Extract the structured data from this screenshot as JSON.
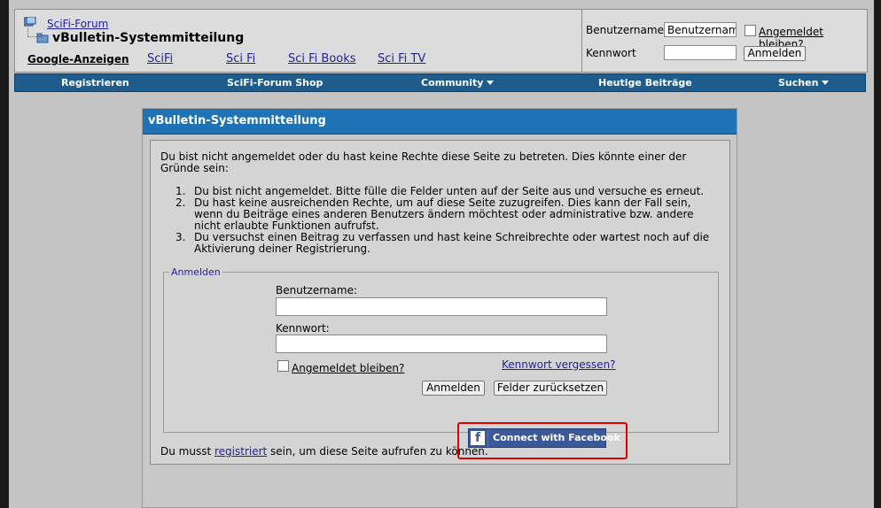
{
  "breadcrumb": {
    "root": "SciFi-Forum",
    "current": "vBulletin-Systemmitteilung"
  },
  "ads": {
    "label": "Google-Anzeigen",
    "links": [
      "SciFi",
      "Sci Fi",
      "Sci Fi Books",
      "Sci Fi TV"
    ]
  },
  "header_login": {
    "username_label": "Benutzername",
    "username_value": "Benutzername",
    "password_label": "Kennwort",
    "remember_label": "Angemeldet bleiben?",
    "login_button": "Anmelden"
  },
  "nav": {
    "items": [
      {
        "label": "Registrieren"
      },
      {
        "label": "SciFi-Forum Shop"
      },
      {
        "label": "Community"
      },
      {
        "label": "Heutige Beiträge"
      },
      {
        "label": "Suchen"
      }
    ]
  },
  "panel": {
    "title": "vBulletin-Systemmitteilung",
    "message": "Du bist nicht angemeldet oder du hast keine Rechte diese Seite zu betreten. Dies könnte einer der Gründe sein:",
    "reasons": [
      "Du bist nicht angemeldet. Bitte fülle die Felder unten auf der Seite aus und versuche es erneut.",
      "Du hast keine ausreichenden Rechte, um auf diese Seite zuzugreifen. Dies kann der Fall sein, wenn du Beiträge eines anderen Benutzers ändern möchtest oder administrative bzw. andere nicht erlaubte Funktionen aufrufst.",
      "Du versuchst einen Beitrag zu verfassen und hast keine Schreibrechte oder wartest noch auf die Aktivierung deiner Registrierung."
    ],
    "numbers": [
      "1.",
      "2.",
      "3."
    ]
  },
  "login_form": {
    "legend": "Anmelden",
    "username_label": "Benutzername:",
    "password_label": "Kennwort:",
    "remember_label": "Angemeldet bleiben?",
    "forgot_link": "Kennwort vergessen?",
    "login_button": "Anmelden",
    "reset_button": "Felder zurücksetzen",
    "facebook_button": "Connect with Facebook"
  },
  "footer": {
    "prefix": "Du musst ",
    "link": "registriert",
    "suffix": " sein, um diese Seite aufrufen zu können."
  }
}
